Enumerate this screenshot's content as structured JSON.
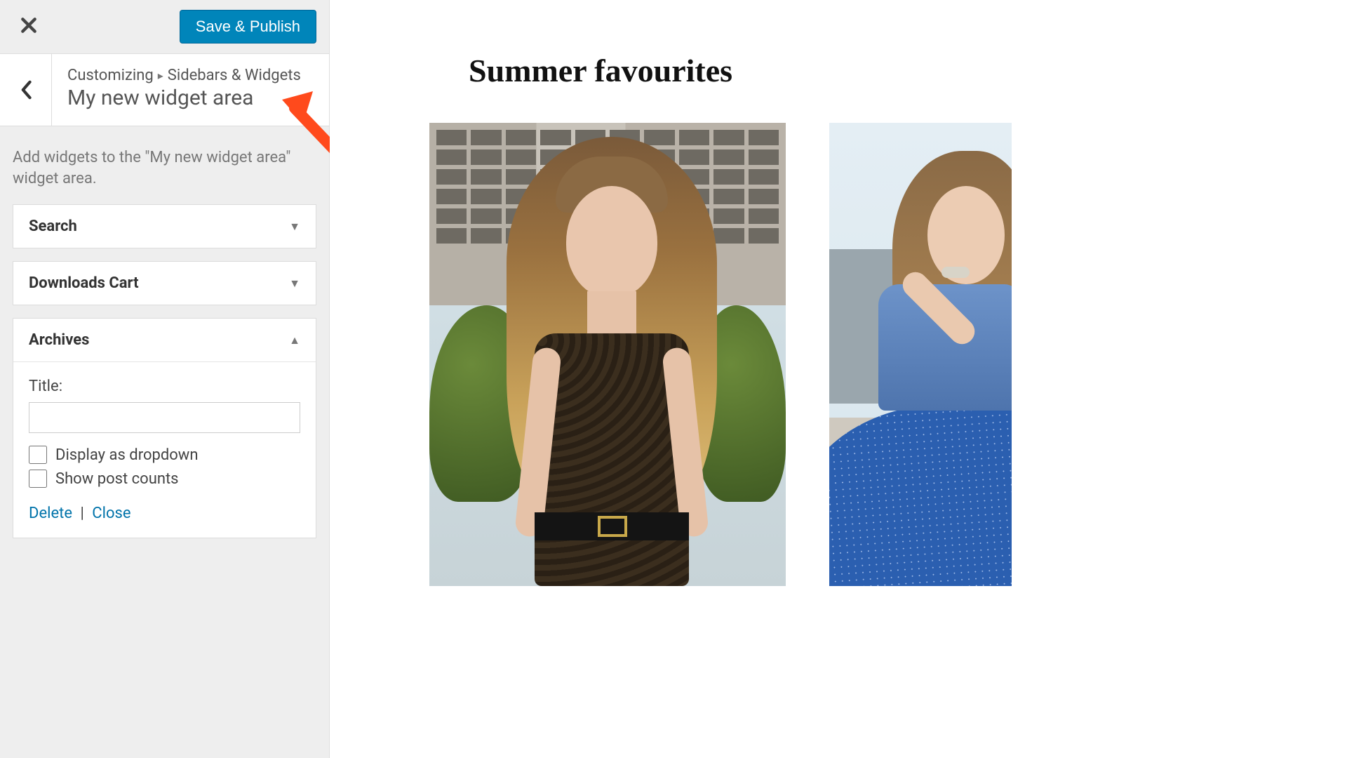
{
  "toolbar": {
    "save_label": "Save & Publish"
  },
  "breadcrumb": {
    "root": "Customizing",
    "section": "Sidebars & Widgets"
  },
  "section_title": "My new widget area",
  "description": "Add widgets to the \"My new widget area\" widget area.",
  "widgets": [
    {
      "label": "Search",
      "expanded": false
    },
    {
      "label": "Downloads Cart",
      "expanded": false
    },
    {
      "label": "Archives",
      "expanded": true
    }
  ],
  "archives_form": {
    "title_label": "Title:",
    "title_value": "",
    "cb_dropdown_label": "Display as dropdown",
    "cb_counts_label": "Show post counts",
    "delete_label": "Delete",
    "close_label": "Close"
  },
  "preview": {
    "heading": "Summer favourites"
  }
}
